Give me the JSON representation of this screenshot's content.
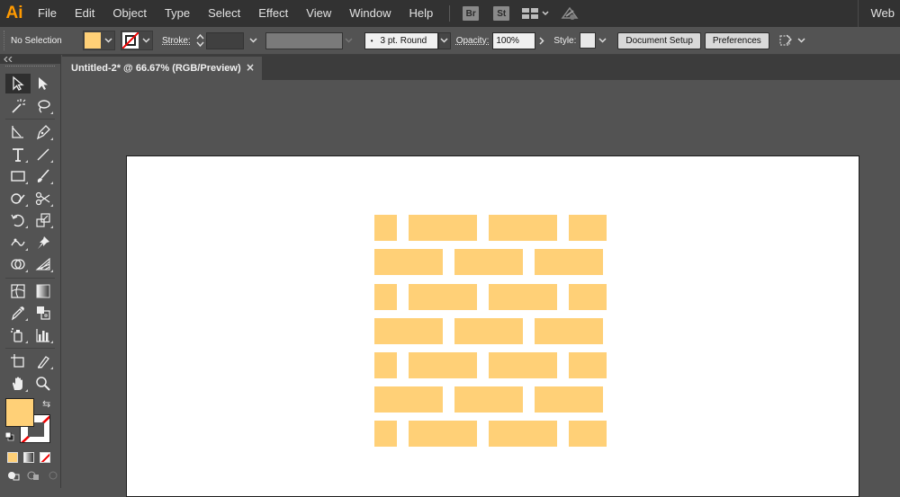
{
  "app": {
    "logo": "Ai",
    "workspace": "Web"
  },
  "menu": [
    "File",
    "Edit",
    "Object",
    "Type",
    "Select",
    "Effect",
    "View",
    "Window",
    "Help"
  ],
  "menubar_apps": [
    "Br",
    "St"
  ],
  "control": {
    "selection_label": "No Selection",
    "fill_color": "#ffd077",
    "stroke_label": "Stroke:",
    "stroke_value": "",
    "brush_label": "3 pt. Round",
    "opacity_label": "Opacity:",
    "opacity_value": "100%",
    "style_label": "Style:",
    "document_setup_label": "Document Setup",
    "preferences_label": "Preferences"
  },
  "document_tab": {
    "title": "Untitled-2* @ 66.67% (RGB/Preview)",
    "close": "×"
  },
  "tools": [
    [
      "selection-tool",
      "direct-selection-tool"
    ],
    [
      "magic-wand-tool",
      "lasso-tool"
    ],
    [
      "curvature-tool",
      "pen-tool"
    ],
    [
      "type-tool",
      "line-segment-tool"
    ],
    [
      "rectangle-tool",
      "paintbrush-tool"
    ],
    [
      "shaper-tool",
      "scissors-tool"
    ],
    [
      "rotate-tool",
      "scale-tool"
    ],
    [
      "puppet-warp-tool",
      "pin-tool"
    ],
    [
      "shape-builder-tool",
      "perspective-grid-tool"
    ],
    [
      "mesh-tool",
      "gradient-tool"
    ],
    [
      "eyedropper-tool",
      "blend-tool"
    ],
    [
      "symbol-sprayer-tool",
      "column-graph-tool"
    ],
    [
      "artboard-tool",
      "slice-tool"
    ],
    [
      "hand-tool",
      "zoom-tool"
    ]
  ],
  "colors": {
    "brick": "#ffd077",
    "fill_swatch": "#ffd077",
    "artboard": "#ffffff",
    "canvas": "#535353"
  },
  "artwork": {
    "description_shape": "brick-wall",
    "rows": 7,
    "brick_color": "#ffd077"
  }
}
